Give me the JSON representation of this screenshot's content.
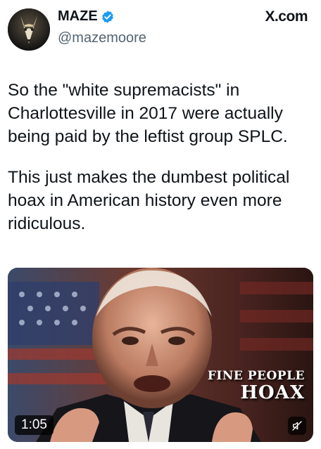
{
  "author": {
    "display_name": "MAZE",
    "handle": "@mazemoore",
    "verified": true,
    "verified_color": "#1d9bf0"
  },
  "source_label": "X.com",
  "post": {
    "paragraphs": [
      "So the \"white supremacists\" in Charlottesville in 2017 were actually being paid by the leftist group SPLC.",
      "This just makes the dumbest political hoax in American history even more ridiculous."
    ]
  },
  "video": {
    "overlay_line1": "FINE PEOPLE",
    "overlay_line2": "HOAX",
    "duration": "1:05",
    "muted_icon": "speaker-muted-icon"
  }
}
